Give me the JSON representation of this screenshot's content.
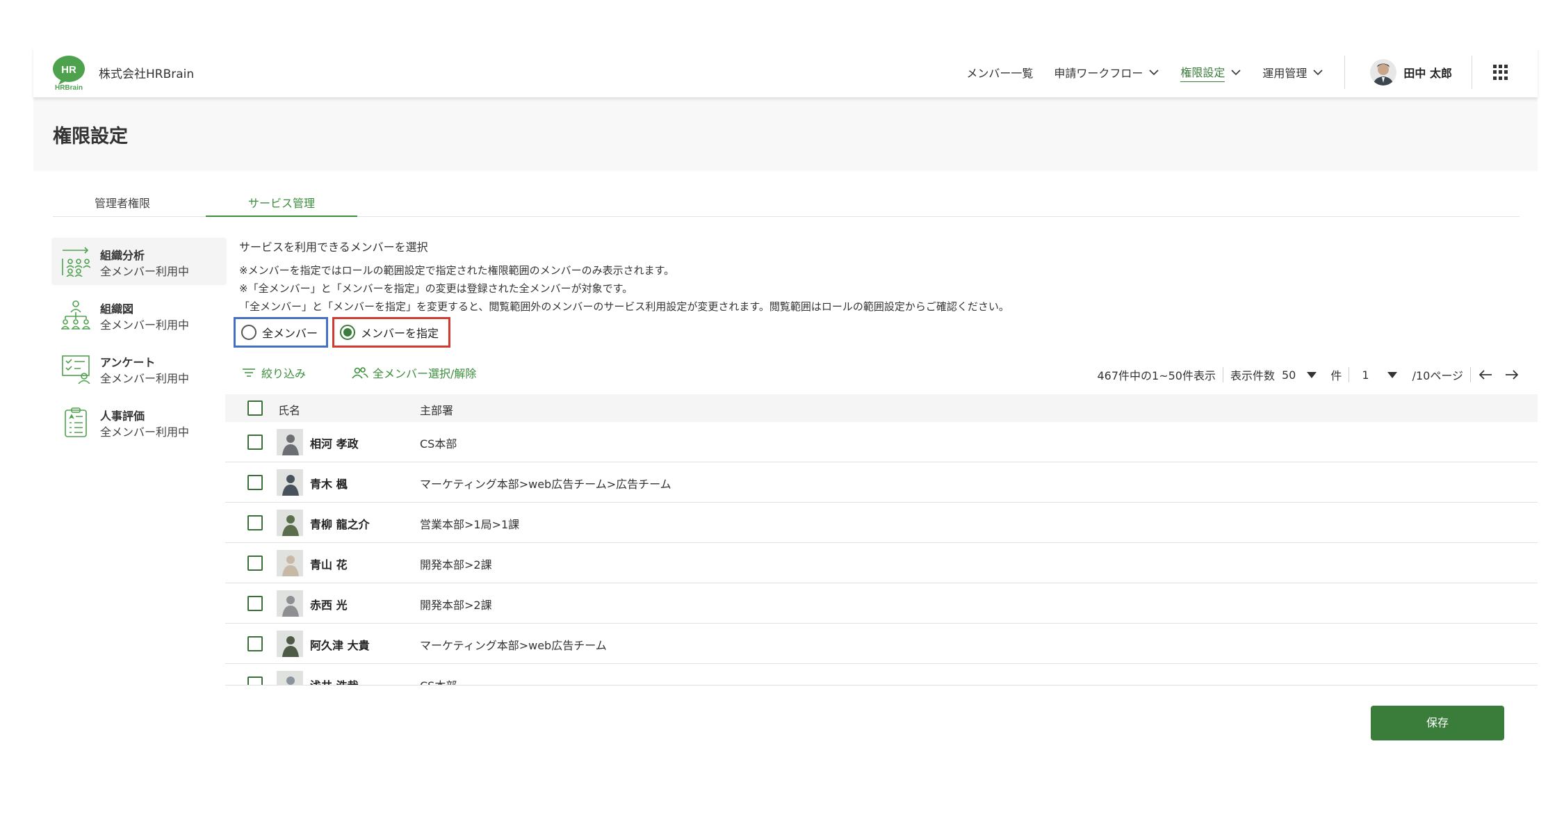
{
  "header": {
    "logo_text": "HR",
    "logo_sub": "HRBrain",
    "company": "株式会社HRBrain",
    "nav": [
      {
        "label": "メンバー一覧",
        "has_menu": false,
        "active": false
      },
      {
        "label": "申請ワークフロー",
        "has_menu": true,
        "active": false
      },
      {
        "label": "権限設定",
        "has_menu": true,
        "active": true
      },
      {
        "label": "運用管理",
        "has_menu": true,
        "active": false
      }
    ],
    "user_name": "田中 太郎"
  },
  "page_title": "権限設定",
  "tabs": [
    {
      "label": "管理者権限",
      "active": false
    },
    {
      "label": "サービス管理",
      "active": true
    }
  ],
  "sidebar": [
    {
      "title": "組織分析",
      "status": "全メンバー利用中",
      "icon": "org-analysis-icon",
      "active": true
    },
    {
      "title": "組織図",
      "status": "全メンバー利用中",
      "icon": "org-chart-icon",
      "active": false
    },
    {
      "title": "アンケート",
      "status": "全メンバー利用中",
      "icon": "survey-icon",
      "active": false
    },
    {
      "title": "人事評価",
      "status": "全メンバー利用中",
      "icon": "evaluation-icon",
      "active": false
    }
  ],
  "main": {
    "heading": "サービスを利用できるメンバーを選択",
    "notes": [
      "※メンバーを指定ではロールの範囲設定で指定された権限範囲のメンバーのみ表示されます。",
      "※「全メンバー」と「メンバーを指定」の変更は登録された全メンバーが対象です。",
      "「全メンバー」と「メンバーを指定」を変更すると、閲覧範囲外のメンバーのサービス利用設定が変更されます。閲覧範囲はロールの範囲設定からご確認ください。"
    ],
    "radio_all": "全メンバー",
    "radio_specify": "メンバーを指定",
    "selected": "specify",
    "filter_label": "絞り込み",
    "select_all_label": "全メンバー選択/解除",
    "pager": {
      "summary": "467件中の1~50件表示",
      "per_page_label": "表示件数",
      "per_page": "50",
      "unit": "件",
      "page": "1",
      "total_pages": "/10ページ"
    },
    "table": {
      "headers": [
        "氏名",
        "主部署"
      ],
      "rows": [
        {
          "name": "相河 孝政",
          "dept": "CS本部"
        },
        {
          "name": "青木 楓",
          "dept": "マーケティング本部>web広告チーム>広告チーム"
        },
        {
          "name": "青柳 龍之介",
          "dept": "営業本部>1局>1課"
        },
        {
          "name": "青山 花",
          "dept": "開発本部>2課"
        },
        {
          "name": "赤西 光",
          "dept": "開発本部>2課"
        },
        {
          "name": "阿久津 大貴",
          "dept": "マーケティング本部>web広告チーム"
        },
        {
          "name": "浅井 浩哉",
          "dept": "CS本部"
        }
      ]
    }
  },
  "save_label": "保存",
  "colors": {
    "accent": "#3a7c3a",
    "radio_all_outline": "#4470c4",
    "radio_specify_outline": "#d03a30"
  }
}
